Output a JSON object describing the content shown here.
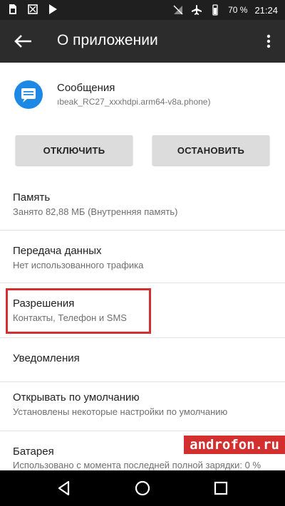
{
  "status_bar": {
    "battery": "70 %",
    "time": "21:24",
    "icons": [
      "sim-icon",
      "image-icon",
      "play-store-icon",
      "no-signal-icon",
      "airplane-icon",
      "battery-icon"
    ]
  },
  "app_bar": {
    "title": "О приложении"
  },
  "app": {
    "name": "Сообщения",
    "package": "ıbeak_RC27_xxxhdpi.arm64-v8a.phone)",
    "icon_color": "#1e88e5"
  },
  "buttons": {
    "disable": "ОТКЛЮЧИТЬ",
    "stop": "ОСТАНОВИТЬ"
  },
  "rows": [
    {
      "title": "Память",
      "subtitle": "Занято 82,88 МБ (Внутренняя память)"
    },
    {
      "title": "Передача данных",
      "subtitle": "Нет использованного трафика"
    },
    {
      "title": "Разрешения",
      "subtitle": "Контакты, Телефон и SMS"
    },
    {
      "title": "Уведомления",
      "subtitle": ""
    },
    {
      "title": "Открывать по умолчанию",
      "subtitle": "Установлены некоторые настройки по умолчанию"
    },
    {
      "title": "Батарея",
      "subtitle": "Использовано с момента последней полной зарядки: 0 %"
    }
  ],
  "highlight_color": "#d32f2f",
  "watermark": "androfon.ru"
}
